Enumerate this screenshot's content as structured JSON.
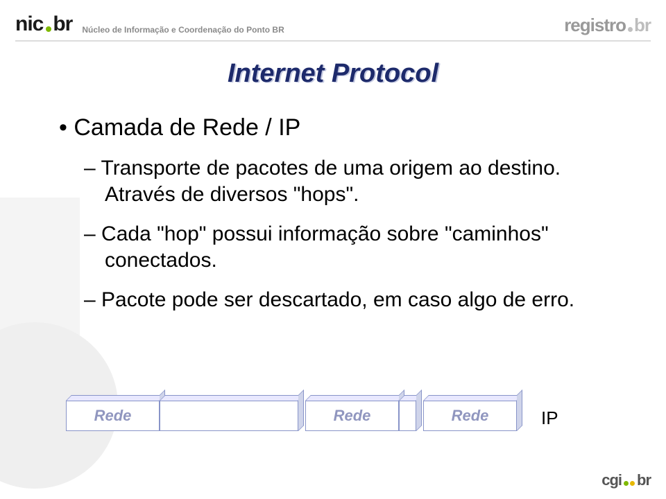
{
  "header": {
    "logo_left_1": "nic",
    "logo_left_2": "br",
    "tagline": "Núcleo de Informação e Coordenação do Ponto BR",
    "logo_right_1": "registro",
    "logo_right_2": "br"
  },
  "title": "Internet Protocol",
  "bullet": "Camada de Rede / IP",
  "subs": [
    "Transporte de pacotes de uma origem ao destino. Através de diversos \"hops\".",
    "Cada \"hop\" possui informação sobre \"caminhos\" conectados.",
    "Pacote pode ser descartado, em caso algo de erro."
  ],
  "diagram": {
    "boxes": [
      "Rede",
      "Rede",
      "Rede"
    ],
    "right_label": "IP"
  },
  "footer": {
    "text1": "cgi",
    "text2": "br"
  }
}
